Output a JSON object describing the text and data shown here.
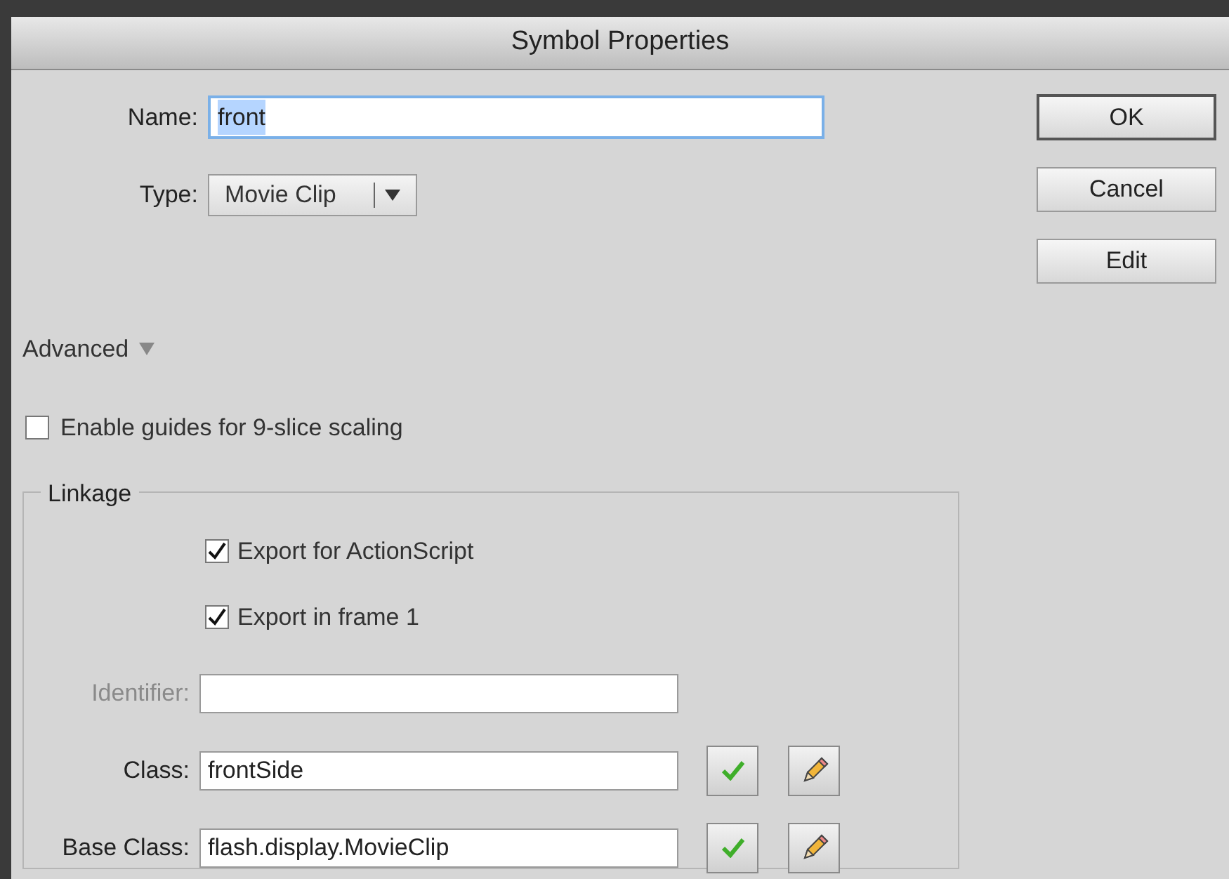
{
  "window": {
    "title": "Symbol Properties"
  },
  "name_field": {
    "label": "Name:",
    "value": "front",
    "text_selected": true,
    "focused": true
  },
  "type_field": {
    "label": "Type:",
    "value": "Movie Clip"
  },
  "buttons": [
    {
      "label": "OK",
      "default": true
    },
    {
      "label": "Cancel",
      "default": false
    },
    {
      "label": "Edit",
      "default": false
    }
  ],
  "advanced": {
    "label": "Advanced",
    "expanded": true
  },
  "slice_guides": {
    "label": "Enable guides for 9-slice scaling",
    "checked": false
  },
  "linkage": {
    "title": "Linkage",
    "options": [
      {
        "label": "Export for ActionScript",
        "checked": true
      },
      {
        "label": "Export in frame 1",
        "checked": true
      }
    ],
    "fields": [
      {
        "kind": "plain",
        "label": "Identifier:",
        "disabled": true
      },
      {
        "kind": "validated",
        "label": "Class:",
        "value": "frontSide",
        "disabled": false
      },
      {
        "kind": "validated",
        "label": "Base Class:",
        "value": "flash.display.MovieClip",
        "disabled": false
      }
    ]
  }
}
